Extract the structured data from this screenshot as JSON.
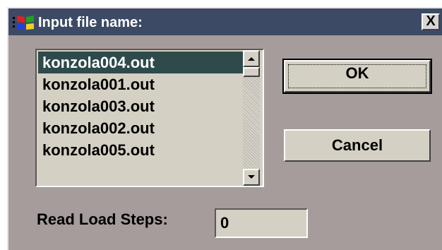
{
  "window": {
    "title": "Input file name:",
    "app_icon": "windows-flag-icon",
    "close_glyph": "X"
  },
  "file_list": {
    "items": [
      "konzola004.out",
      "konzola001.out",
      "konzola003.out",
      "konzola002.out",
      "konzola005.out"
    ],
    "selected": "konzola004.out"
  },
  "buttons": {
    "ok_label": "OK",
    "cancel_label": "Cancel"
  },
  "load_steps": {
    "label": "Read Load Steps:",
    "value": "0"
  },
  "colors": {
    "titlebar": "#3d4a66",
    "dialog_bg": "#a69c9c",
    "selection": "#2e4a4a"
  }
}
